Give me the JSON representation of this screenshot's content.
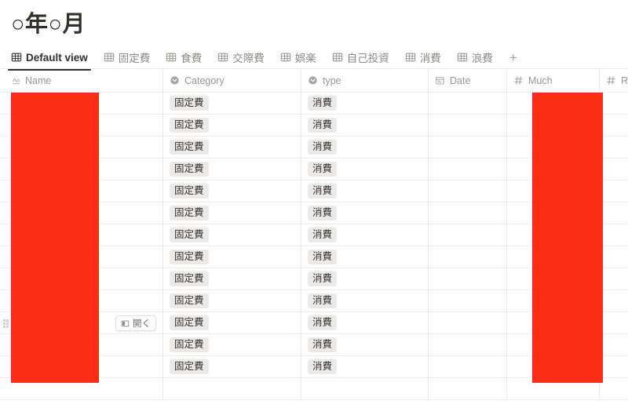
{
  "page": {
    "title": "○年○月"
  },
  "tabs": {
    "icon": "table-grid-icon",
    "items": [
      {
        "label": "Default view",
        "active": true
      },
      {
        "label": "固定費",
        "active": false
      },
      {
        "label": "食費",
        "active": false
      },
      {
        "label": "交際費",
        "active": false
      },
      {
        "label": "娯楽",
        "active": false
      },
      {
        "label": "自己投資",
        "active": false
      },
      {
        "label": "消費",
        "active": false
      },
      {
        "label": "浪費",
        "active": false
      }
    ],
    "add_label": "+"
  },
  "table": {
    "columns": [
      {
        "label": "Name",
        "icon": "text-aa-icon",
        "type": "title"
      },
      {
        "label": "Category",
        "icon": "select-icon",
        "type": "select"
      },
      {
        "label": "type",
        "icon": "select-icon",
        "type": "select"
      },
      {
        "label": "Date",
        "icon": "calendar-icon",
        "type": "date"
      },
      {
        "label": "Much",
        "icon": "number-hash-icon",
        "type": "number"
      },
      {
        "label": "Re",
        "icon": "number-hash-icon",
        "type": "number"
      }
    ],
    "rows": [
      {
        "name": "",
        "category": "固定費",
        "type": "消費",
        "date": "",
        "much": "",
        "re": "",
        "hover": false
      },
      {
        "name": "",
        "category": "固定費",
        "type": "消費",
        "date": "",
        "much": "",
        "re": "",
        "hover": false
      },
      {
        "name": "",
        "category": "固定費",
        "type": "消費",
        "date": "",
        "much": "",
        "re": "",
        "hover": false
      },
      {
        "name": "",
        "category": "固定費",
        "type": "消費",
        "date": "",
        "much": "",
        "re": "",
        "hover": false
      },
      {
        "name": "",
        "category": "固定費",
        "type": "消費",
        "date": "",
        "much": "",
        "re": "",
        "hover": false
      },
      {
        "name": "",
        "category": "固定費",
        "type": "消費",
        "date": "",
        "much": "",
        "re": "",
        "hover": false
      },
      {
        "name": "",
        "category": "固定費",
        "type": "消費",
        "date": "",
        "much": "",
        "re": "",
        "hover": false
      },
      {
        "name": "",
        "category": "固定費",
        "type": "消費",
        "date": "",
        "much": "",
        "re": "",
        "hover": false
      },
      {
        "name": "",
        "category": "固定費",
        "type": "消費",
        "date": "",
        "much": "",
        "re": "",
        "hover": false
      },
      {
        "name": "",
        "category": "固定費",
        "type": "消費",
        "date": "",
        "much": "",
        "re": "",
        "hover": false
      },
      {
        "name": "",
        "category": "固定費",
        "type": "消費",
        "date": "",
        "much": "",
        "re": "",
        "hover": true
      },
      {
        "name": "",
        "category": "固定費",
        "type": "消費",
        "date": "",
        "much": "",
        "re": "",
        "hover": false
      },
      {
        "name": "",
        "category": "固定費",
        "type": "消費",
        "date": "",
        "much": "",
        "re": "",
        "hover": false
      }
    ],
    "empty_row": true,
    "row_actions": {
      "open_label": "開く",
      "open_icon": "open-panel-icon",
      "drag_handle_icon": "drag-dots-icon"
    }
  },
  "redactions": [
    {
      "name": "name-column-redaction",
      "column": "Name",
      "color": "#FA2C13"
    },
    {
      "name": "much-column-redaction",
      "column": "Much",
      "color": "#FA2C13"
    }
  ],
  "colors": {
    "redaction": "#FA2C13",
    "text_primary": "#32302c",
    "text_muted": "#9b9894",
    "tag_bg": "#eceae9",
    "border": "#eeecea"
  }
}
